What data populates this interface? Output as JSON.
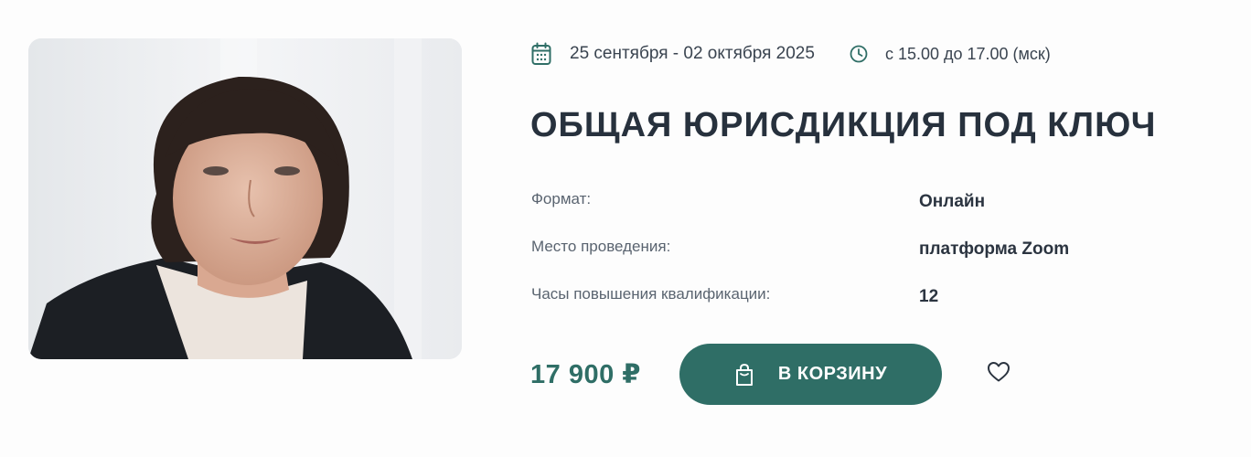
{
  "event": {
    "date_range": "25 сентября - 02 октября 2025",
    "time_range": "с 15.00 до 17.00 (мск)",
    "title": "ОБЩАЯ ЮРИСДИКЦИЯ ПОД КЛЮЧ",
    "details": [
      {
        "label": "Формат:",
        "value": "Онлайн"
      },
      {
        "label": "Место проведения:",
        "value": "платформа Zoom"
      },
      {
        "label": "Часы повышения квалификации:",
        "value": "12"
      }
    ],
    "price": "17 900 ₽",
    "cart_button_label": "В КОРЗИНУ"
  },
  "icons": {
    "date": "calendar-icon",
    "time": "clock-icon",
    "cart": "shopping-bag-icon",
    "favorite": "heart-icon"
  },
  "colors": {
    "accent": "#2f6e66",
    "title": "#27313d",
    "label": "#5a6470"
  }
}
